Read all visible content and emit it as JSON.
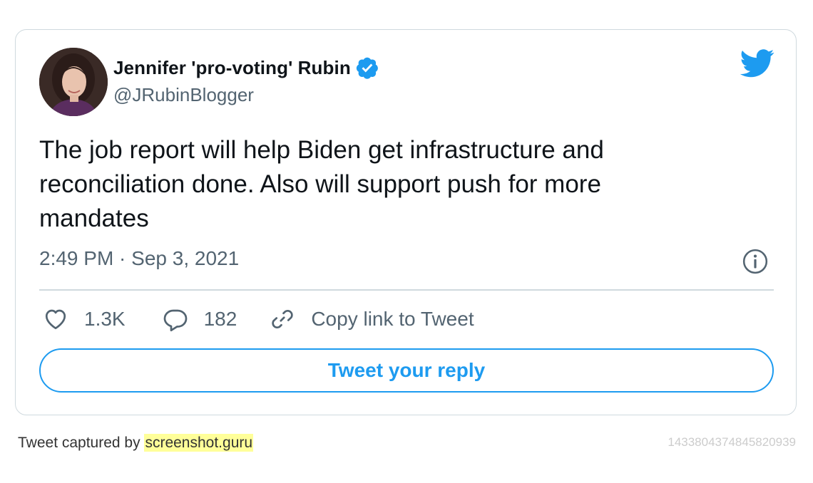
{
  "author": {
    "name": "Jennifer 'pro-voting' Rubin",
    "handle": "@JRubinBlogger",
    "verified": true
  },
  "tweet": {
    "text": "The job report will help Biden get infrastructure and\nreconciliation done. Also will support push for more\nmandates",
    "timestamp": "2:49 PM · Sep 3, 2021"
  },
  "actions": {
    "likes": "1.3K",
    "replies": "182",
    "copy_link_label": "Copy link to Tweet"
  },
  "reply_button_label": "Tweet your reply",
  "footer": {
    "captured_by_text": "Tweet captured by",
    "brand": "screenshot.guru",
    "tweet_id": "1433804374845820939"
  },
  "icons": {
    "logo": "twitter-bird-icon",
    "verified": "verified-badge-icon",
    "info": "info-icon",
    "like": "heart-icon",
    "reply": "reply-bubble-icon",
    "link": "link-icon"
  },
  "colors": {
    "accent": "#1d9bf0",
    "text_primary": "#0f1419",
    "text_secondary": "#536471",
    "border": "#cfd9de",
    "highlight": "#ffff99"
  }
}
